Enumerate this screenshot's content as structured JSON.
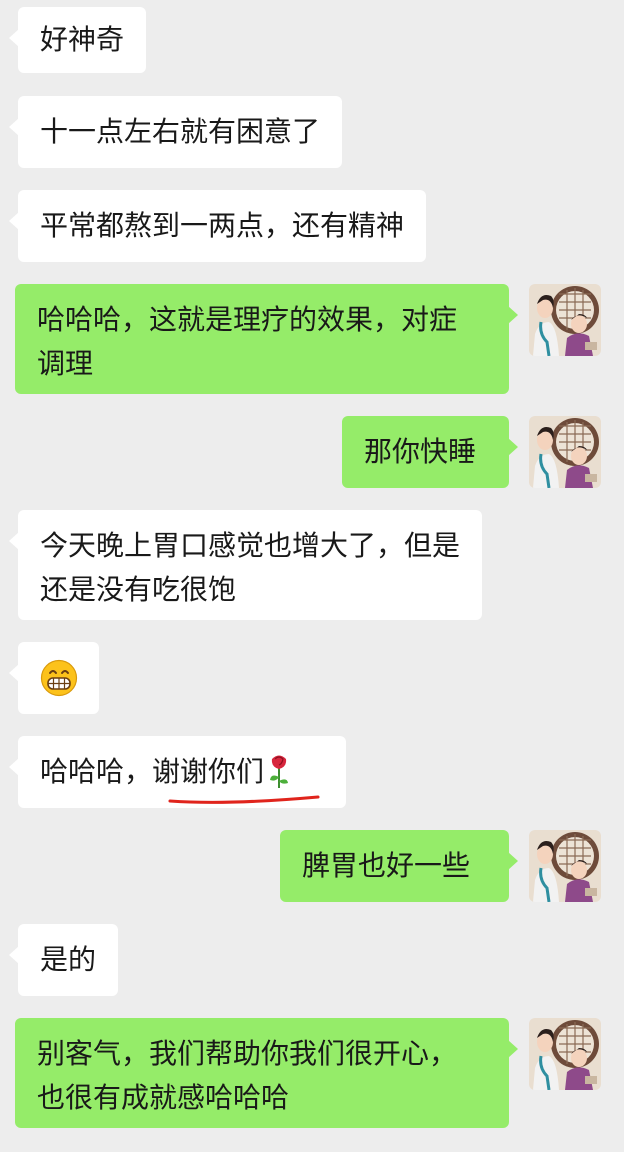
{
  "chat": {
    "messages": [
      {
        "side": "left",
        "lines": [
          "好神奇"
        ]
      },
      {
        "side": "left",
        "lines": [
          "十一点左右就有困意了"
        ]
      },
      {
        "side": "left",
        "lines": [
          "平常都熬到一两点，还有精神"
        ]
      },
      {
        "side": "right",
        "lines": [
          "哈哈哈，这就是理疗的效果，对症",
          "调理"
        ]
      },
      {
        "side": "right",
        "lines": [
          "那你快睡"
        ]
      },
      {
        "side": "left",
        "lines": [
          "今天晚上胃口感觉也增大了，但是",
          "还是没有吃很饱"
        ]
      },
      {
        "side": "left",
        "emoji": "grinning-face-emoji"
      },
      {
        "side": "left",
        "prefix": "哈哈哈，",
        "text": "谢谢你们",
        "emoji": "rose-emoji",
        "annotation": "red-underline"
      },
      {
        "side": "right",
        "lines": [
          "脾胃也好一些"
        ]
      },
      {
        "side": "left",
        "lines": [
          "是的"
        ]
      },
      {
        "side": "right",
        "lines": [
          "别客气，我们帮助你我们很开心，",
          "也很有成就感哈哈哈"
        ]
      }
    ]
  },
  "colors": {
    "background": "#ededed",
    "incoming_bubble": "#ffffff",
    "outgoing_bubble": "#95ec69",
    "text": "#191919",
    "annotation": "#e0241c"
  },
  "avatar": {
    "icon": "therapist-avatar-icon"
  }
}
